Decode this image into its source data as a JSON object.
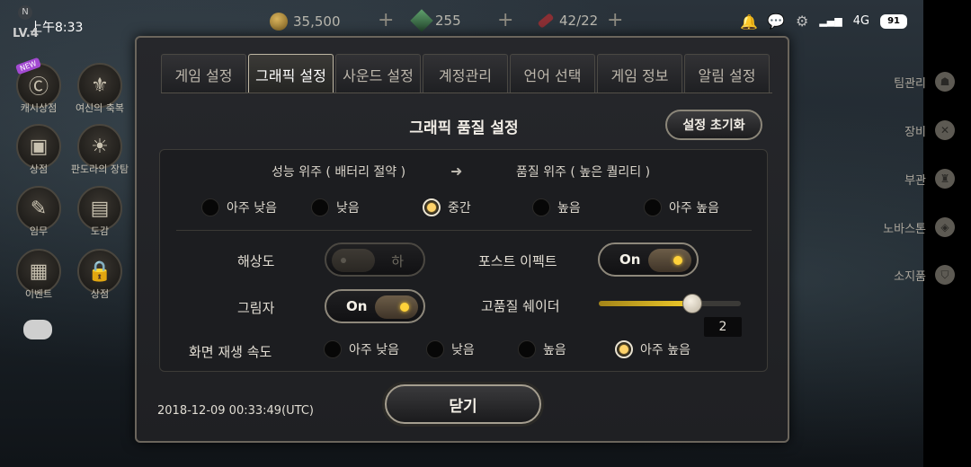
{
  "status_bar": {
    "time": "上午8:33",
    "level": "LV.4",
    "badge": "N",
    "gold": "35,500",
    "gems": "255",
    "keys": "42/22",
    "network": "4G",
    "battery": "91"
  },
  "left_menu": [
    {
      "label": "캐시상점",
      "new": "NEW"
    },
    {
      "label": "여신의 축복"
    },
    {
      "label": "상점"
    },
    {
      "label": "판도라의 장탐"
    },
    {
      "label": "임무"
    },
    {
      "label": "도감"
    },
    {
      "label": "이벤트"
    },
    {
      "label": "상점"
    }
  ],
  "right_menu": [
    {
      "label": "팀관리"
    },
    {
      "label": "장비"
    },
    {
      "label": "부관"
    },
    {
      "label": "노바스톤"
    },
    {
      "label": "소지품"
    }
  ],
  "tabs": [
    "게임 설정",
    "그래픽 설정",
    "사운드 설정",
    "계정관리",
    "언어 선택",
    "게임 정보",
    "알림 설정"
  ],
  "active_tab": "그래픽 설정",
  "panel": {
    "title": "그래픽 품질 설정",
    "reset_label": "설정 초기화",
    "perf_label": "성능 위주 ( 배터리 절약 )",
    "quality_label": "품질 위주 ( 높은 퀄리티 )",
    "quality_levels": [
      "아주 낮음",
      "낮음",
      "중간",
      "높음",
      "아주 높음"
    ],
    "quality_selected": "중간",
    "resolution_label": "해상도",
    "resolution_value": "하",
    "post_effect_label": "포스트 이펙트",
    "post_effect_value": "On",
    "shadow_label": "그림자",
    "shadow_value": "On",
    "shader_label": "고품질 쉐이더",
    "shader_value": "2",
    "shader_fraction": 0.66,
    "frame_rate_label": "화면 재생 속도",
    "frame_rates": [
      "아주 낮음",
      "낮음",
      "높음",
      "아주 높음"
    ],
    "frame_rate_selected": "아주 높음"
  },
  "footer": {
    "timestamp": "2018-12-09 00:33:49(UTC)",
    "close_label": "닫기"
  },
  "colors": {
    "accent": "#ffd23a",
    "dialog_bg": "#222326",
    "border": "#8e887b"
  }
}
